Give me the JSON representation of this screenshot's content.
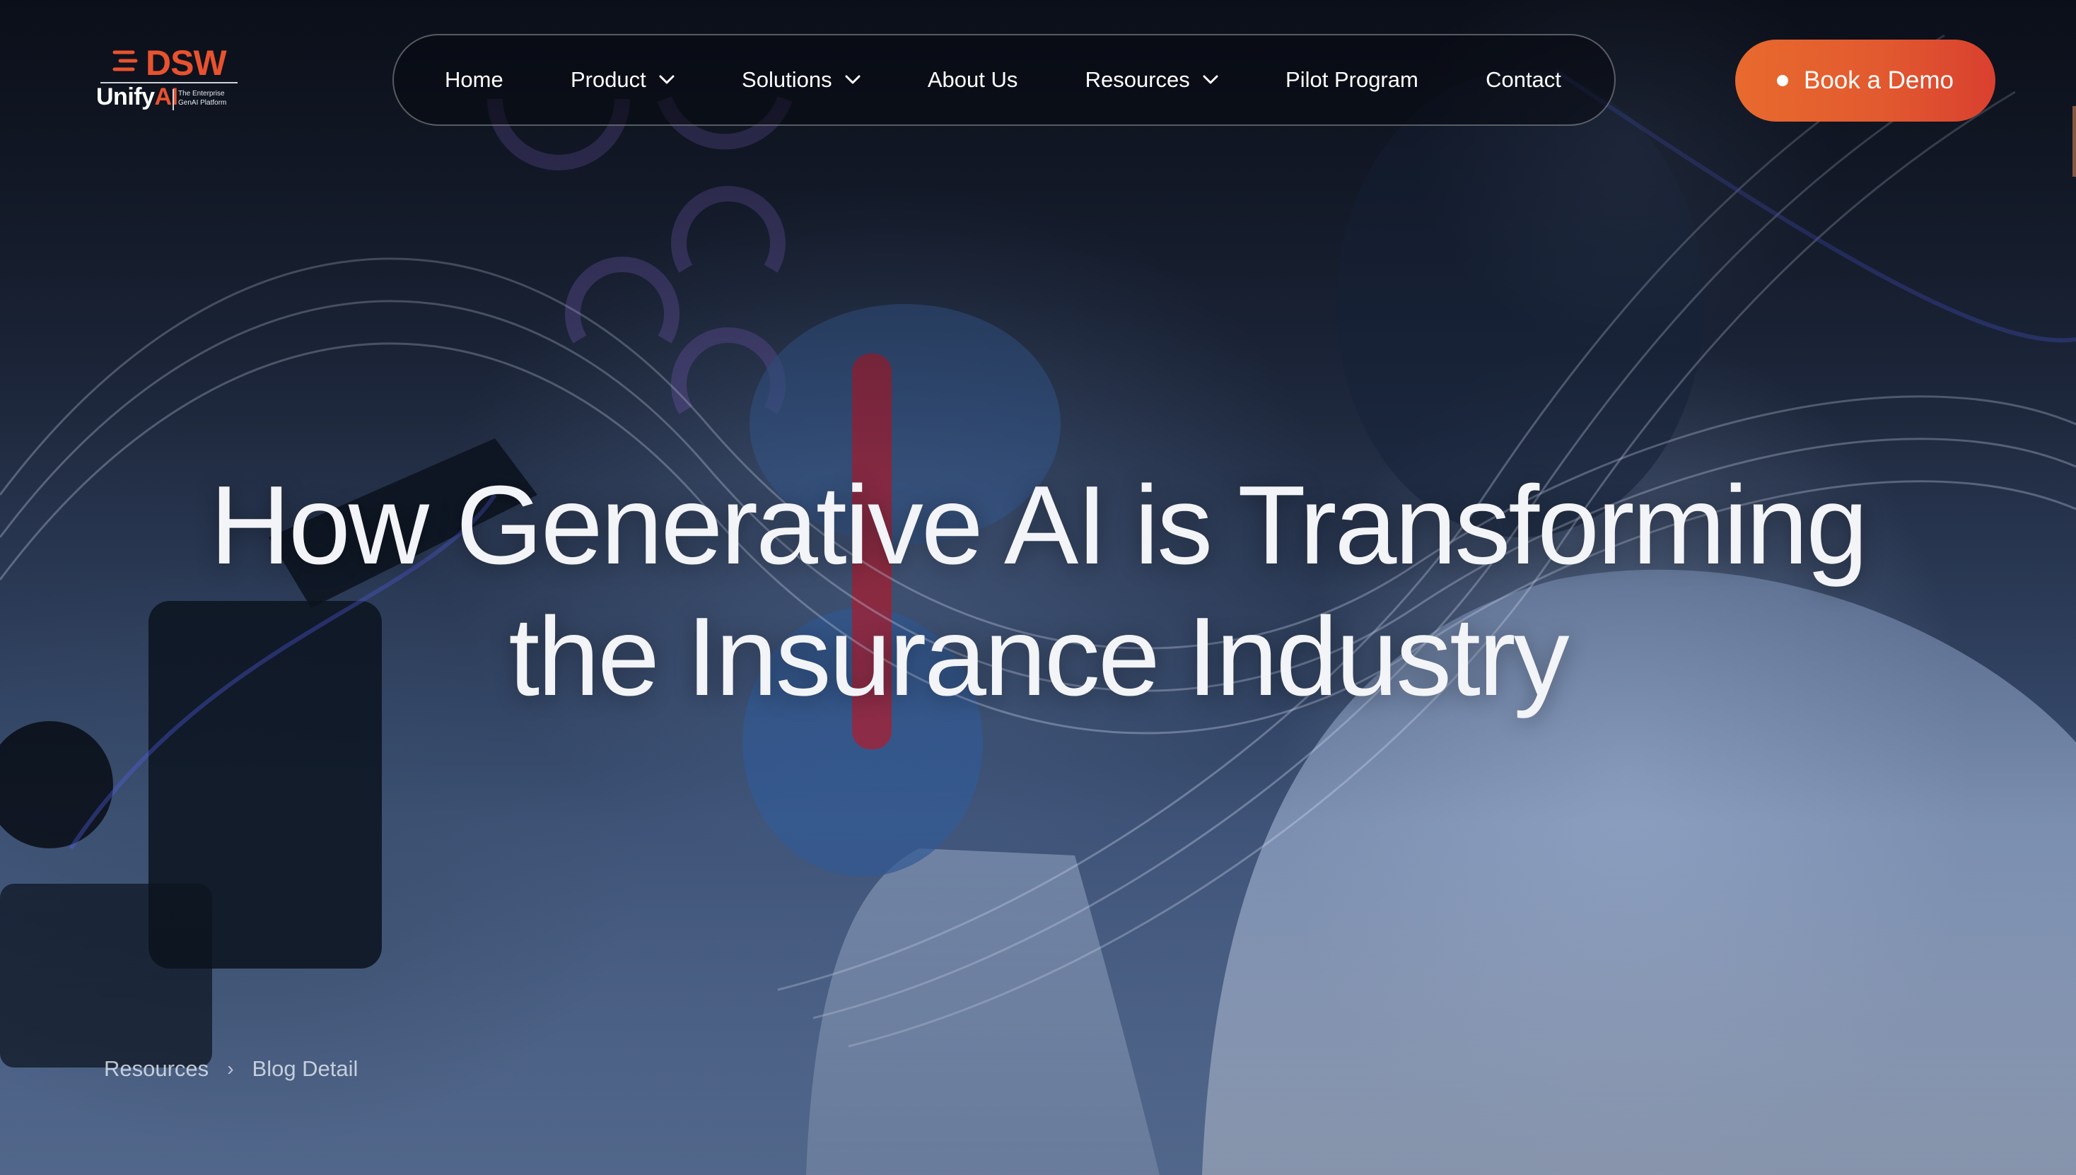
{
  "brand": {
    "logo_top": "DSW",
    "logo_unify": "Unify",
    "logo_ai": "AI",
    "tagline_line1": "The Enterprise",
    "tagline_line2": "GenAI Platform",
    "accent_color": "#e8522f"
  },
  "nav": {
    "items": [
      {
        "label": "Home",
        "has_dropdown": false
      },
      {
        "label": "Product",
        "has_dropdown": true
      },
      {
        "label": "Solutions",
        "has_dropdown": true
      },
      {
        "label": "About Us",
        "has_dropdown": false
      },
      {
        "label": "Resources",
        "has_dropdown": true
      },
      {
        "label": "Pilot Program",
        "has_dropdown": false
      },
      {
        "label": "Contact",
        "has_dropdown": false
      }
    ]
  },
  "cta": {
    "label": "Book a Demo",
    "color_start": "#e86a2e",
    "color_end": "#d9402f"
  },
  "hero": {
    "title_line1": "How Generative AI is Transforming",
    "title_line2": "the Insurance Industry"
  },
  "breadcrumb": {
    "items": [
      "Resources",
      "Blog Detail"
    ],
    "separator": "›"
  }
}
